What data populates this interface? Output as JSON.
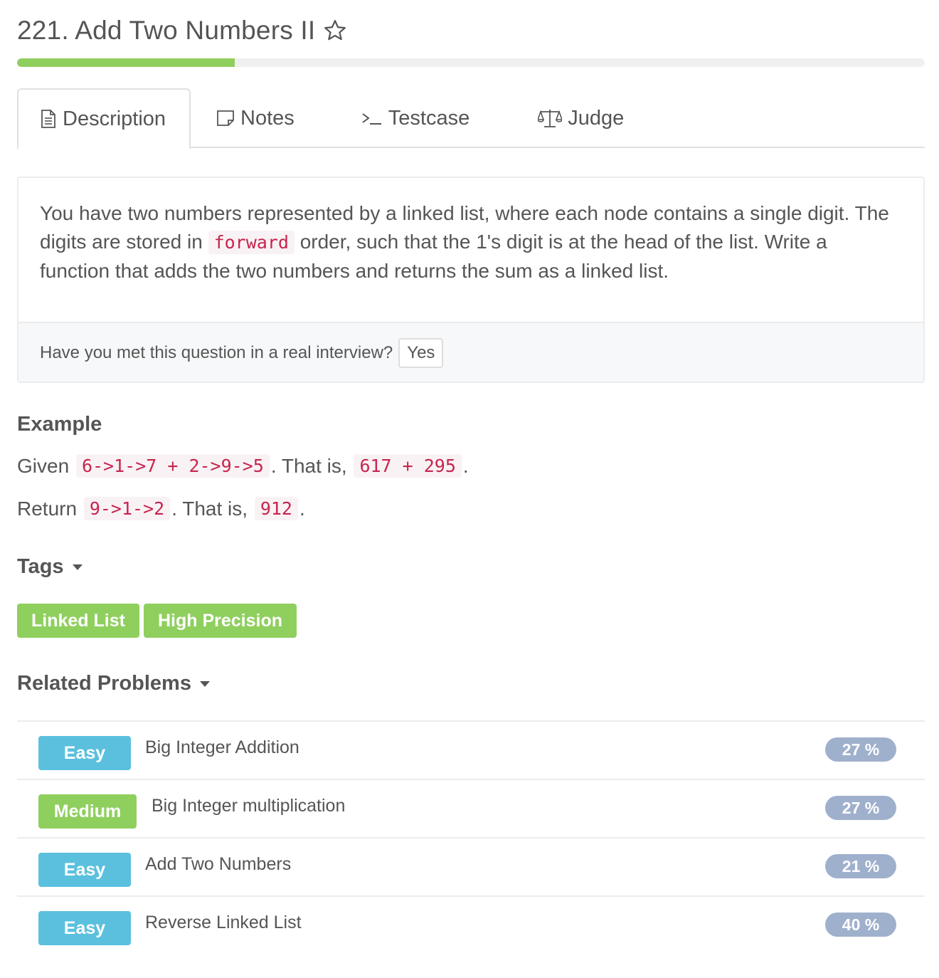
{
  "header": {
    "title": "221. Add Two Numbers II",
    "progress": 0.24
  },
  "tabs": [
    {
      "label": "Description",
      "icon": "document-icon"
    },
    {
      "label": "Notes",
      "icon": "note-icon"
    },
    {
      "label": "Testcase",
      "icon": "terminal-icon"
    },
    {
      "label": "Judge",
      "icon": "scale-icon"
    }
  ],
  "description": {
    "text_before": "You have two numbers represented by a linked list, where each node contains a single digit. The digits are stored in ",
    "code": "forward",
    "text_after": " order, such that the 1's digit is at the head of the list. Write a function that adds the two numbers and returns the sum as a linked list.",
    "interview_question": "Have you met this question in a real interview?",
    "yes_label": "Yes"
  },
  "example": {
    "heading": "Example",
    "line1": {
      "prefix": "Given ",
      "code1": "6->1->7 + 2->9->5",
      "middle": ". That is, ",
      "code2": "617 + 295",
      "suffix": "."
    },
    "line2": {
      "prefix": "Return ",
      "code1": "9->1->2",
      "middle": ". That is, ",
      "code2": "912",
      "suffix": "."
    }
  },
  "tags": {
    "heading": "Tags",
    "items": [
      "Linked List",
      "High Precision"
    ]
  },
  "related": {
    "heading": "Related Problems",
    "items": [
      {
        "difficulty": "Easy",
        "name": "Big Integer Addition",
        "rate": "27 %"
      },
      {
        "difficulty": "Medium",
        "name": "Big Integer multiplication",
        "rate": "27 %"
      },
      {
        "difficulty": "Easy",
        "name": "Add Two Numbers",
        "rate": "21 %"
      },
      {
        "difficulty": "Easy",
        "name": "Reverse Linked List",
        "rate": "40 %"
      }
    ]
  },
  "colors": {
    "accent_green": "#8fcf5e",
    "easy_blue": "#5bc0de",
    "rate_badge": "#9fb0cc",
    "code_red": "#c7254e"
  }
}
